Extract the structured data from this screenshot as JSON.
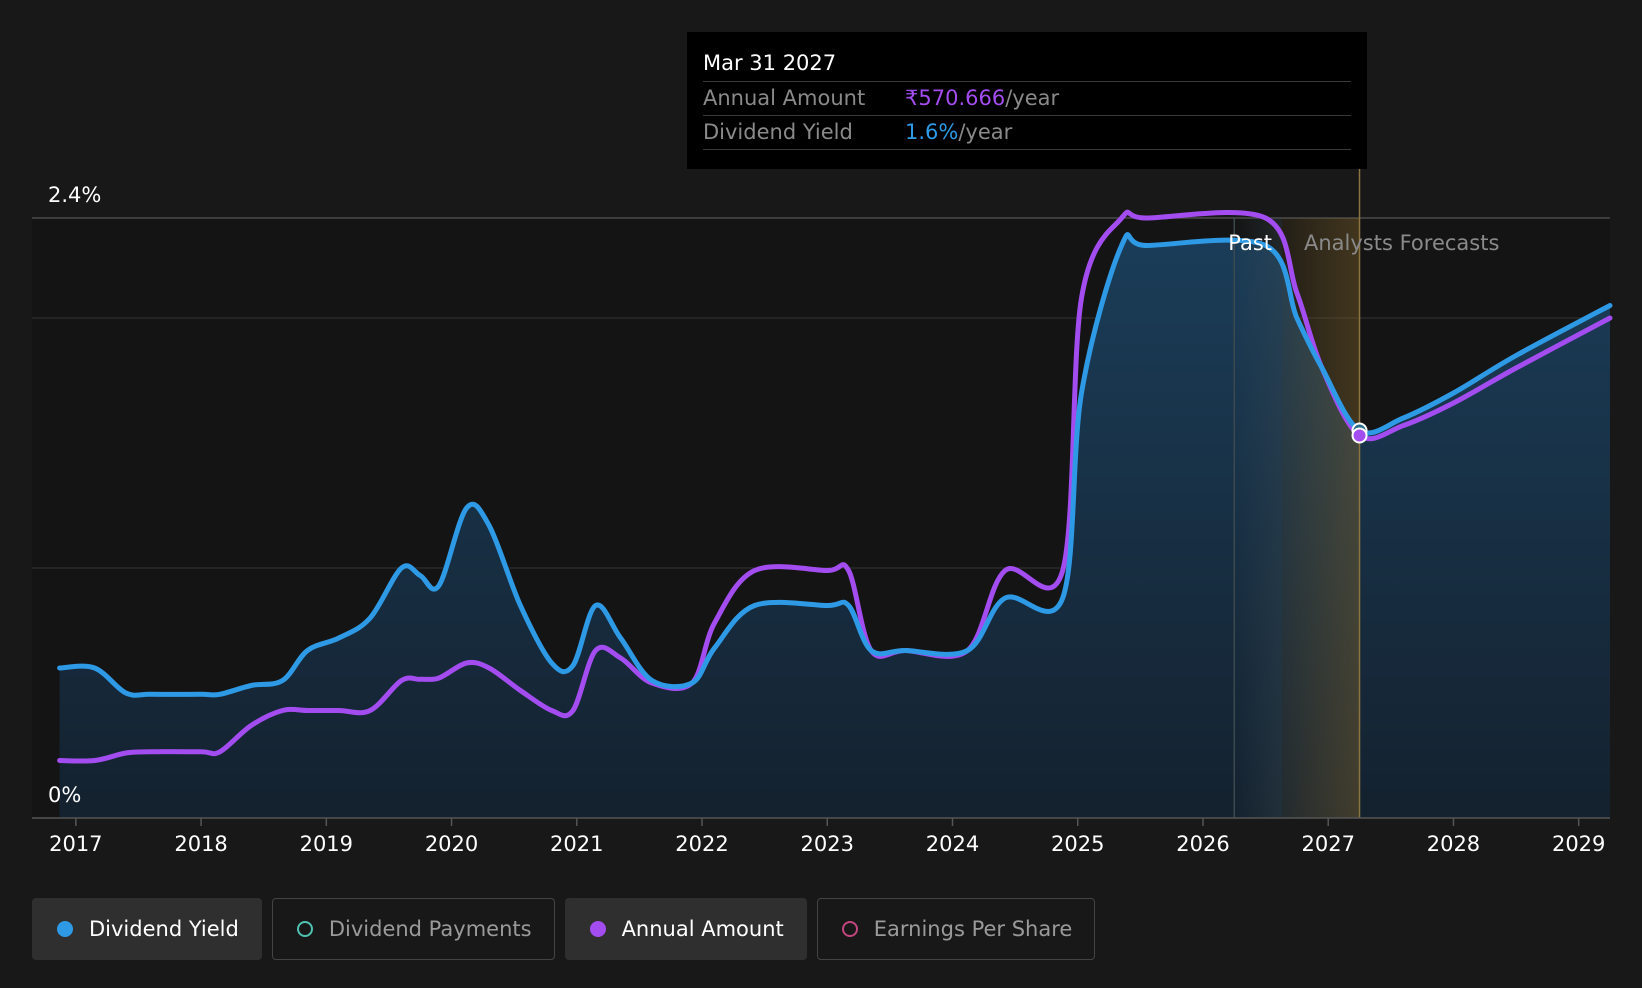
{
  "tooltip": {
    "date": "Mar 31 2027",
    "rows": [
      {
        "label": "Annual Amount",
        "value": "₹570.666",
        "unit": "/year"
      },
      {
        "label": "Dividend Yield",
        "value": "1.6%",
        "unit": "/year"
      }
    ]
  },
  "regions": {
    "past": "Past",
    "forecast": "Analysts Forecasts"
  },
  "legend": [
    {
      "label": "Dividend Yield",
      "color": "#2e9ae6",
      "filled": true,
      "active": true
    },
    {
      "label": "Dividend Payments",
      "color": "#4fc1b0",
      "filled": false,
      "active": false
    },
    {
      "label": "Annual Amount",
      "color": "#a34df0",
      "filled": true,
      "active": true
    },
    {
      "label": "Earnings Per Share",
      "color": "#c2457e",
      "filled": false,
      "active": false
    }
  ],
  "chart_data": {
    "type": "line",
    "xlim": [
      2016.65,
      2029.25
    ],
    "ylim": [
      0,
      2.4
    ],
    "y_tick_labels": [
      {
        "value": 2.4,
        "label": "2.4%"
      },
      {
        "value": 0,
        "label": "0%"
      }
    ],
    "gridlines": [
      2.0,
      1.0
    ],
    "x_ticks": [
      2017,
      2018,
      2019,
      2020,
      2021,
      2022,
      2023,
      2024,
      2025,
      2026,
      2027,
      2028,
      2029
    ],
    "past_boundary": 2026.25,
    "forecast_band": [
      2026.63,
      2027.25
    ],
    "tooltip_x": 2027.25,
    "series": [
      {
        "name": "Dividend Yield",
        "color": "#2e9ae6",
        "points": [
          [
            2016.87,
            0.6
          ],
          [
            2017.15,
            0.6
          ],
          [
            2017.4,
            0.5
          ],
          [
            2017.6,
            0.495
          ],
          [
            2018.0,
            0.495
          ],
          [
            2018.15,
            0.495
          ],
          [
            2018.4,
            0.53
          ],
          [
            2018.65,
            0.55
          ],
          [
            2018.85,
            0.67
          ],
          [
            2019.1,
            0.72
          ],
          [
            2019.35,
            0.8
          ],
          [
            2019.6,
            1.0
          ],
          [
            2019.75,
            0.97
          ],
          [
            2019.9,
            0.93
          ],
          [
            2020.12,
            1.24
          ],
          [
            2020.3,
            1.17
          ],
          [
            2020.55,
            0.85
          ],
          [
            2020.8,
            0.62
          ],
          [
            2020.97,
            0.61
          ],
          [
            2021.15,
            0.85
          ],
          [
            2021.35,
            0.72
          ],
          [
            2021.6,
            0.55
          ],
          [
            2021.92,
            0.54
          ],
          [
            2022.1,
            0.68
          ],
          [
            2022.42,
            0.85
          ],
          [
            2023.0,
            0.85
          ],
          [
            2023.17,
            0.85
          ],
          [
            2023.35,
            0.67
          ],
          [
            2023.62,
            0.67
          ],
          [
            2024.12,
            0.67
          ],
          [
            2024.42,
            0.88
          ],
          [
            2024.88,
            0.88
          ],
          [
            2025.03,
            1.7
          ],
          [
            2025.35,
            2.29
          ],
          [
            2025.55,
            2.29
          ],
          [
            2026.5,
            2.29
          ],
          [
            2026.75,
            2.0
          ],
          [
            2026.95,
            1.8
          ],
          [
            2027.25,
            1.55
          ],
          [
            2027.6,
            1.6
          ],
          [
            2028.0,
            1.7
          ],
          [
            2028.5,
            1.85
          ],
          [
            2029.25,
            2.05
          ]
        ]
      },
      {
        "name": "Annual Amount",
        "color": "#a34df0",
        "points": [
          [
            2016.87,
            0.23
          ],
          [
            2017.15,
            0.23
          ],
          [
            2017.4,
            0.26
          ],
          [
            2017.6,
            0.265
          ],
          [
            2018.0,
            0.265
          ],
          [
            2018.15,
            0.265
          ],
          [
            2018.4,
            0.37
          ],
          [
            2018.65,
            0.43
          ],
          [
            2018.85,
            0.43
          ],
          [
            2019.1,
            0.43
          ],
          [
            2019.35,
            0.43
          ],
          [
            2019.6,
            0.55
          ],
          [
            2019.75,
            0.555
          ],
          [
            2019.9,
            0.56
          ],
          [
            2020.12,
            0.62
          ],
          [
            2020.3,
            0.6
          ],
          [
            2020.55,
            0.51
          ],
          [
            2020.8,
            0.43
          ],
          [
            2020.97,
            0.43
          ],
          [
            2021.15,
            0.67
          ],
          [
            2021.35,
            0.64
          ],
          [
            2021.6,
            0.54
          ],
          [
            2021.92,
            0.54
          ],
          [
            2022.1,
            0.78
          ],
          [
            2022.42,
            0.99
          ],
          [
            2023.0,
            0.99
          ],
          [
            2023.17,
            0.99
          ],
          [
            2023.35,
            0.67
          ],
          [
            2023.62,
            0.67
          ],
          [
            2024.12,
            0.67
          ],
          [
            2024.42,
            0.99
          ],
          [
            2024.88,
            0.99
          ],
          [
            2025.03,
            2.08
          ],
          [
            2025.35,
            2.4
          ],
          [
            2025.55,
            2.4
          ],
          [
            2026.5,
            2.4
          ],
          [
            2026.75,
            2.1
          ],
          [
            2026.95,
            1.8
          ],
          [
            2027.25,
            1.53
          ],
          [
            2027.6,
            1.57
          ],
          [
            2028.0,
            1.66
          ],
          [
            2028.5,
            1.8
          ],
          [
            2029.25,
            2.0
          ]
        ]
      }
    ]
  }
}
